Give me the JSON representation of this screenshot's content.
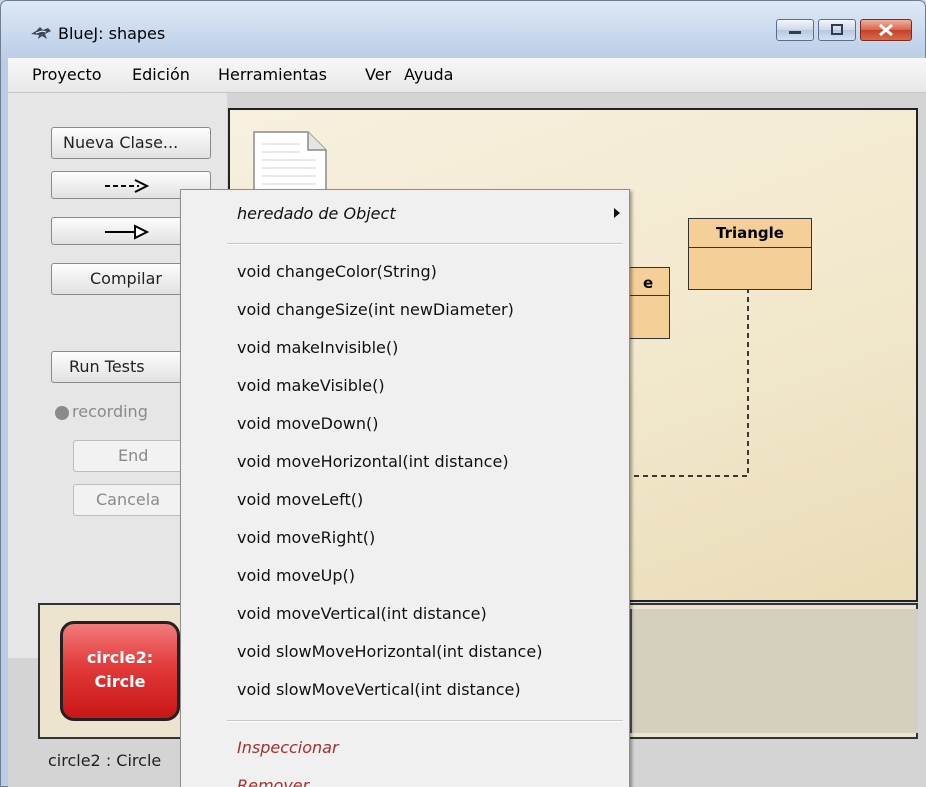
{
  "window": {
    "title": "BlueJ:  shapes"
  },
  "menubar": {
    "items": [
      "Proyecto",
      "Edición",
      "Herramientas",
      "Ver",
      "Ayuda"
    ]
  },
  "toolbar": {
    "new_class": "Nueva Clase...",
    "compile": "Compilar",
    "run_tests": "Run Tests",
    "recording": "recording",
    "end": "End",
    "cancel": "Cancela"
  },
  "diagram": {
    "classes": [
      "Triangle",
      "e"
    ]
  },
  "object_bench": {
    "object_name": "circle2:",
    "object_class": "Circle"
  },
  "status": "circle2 : Circle",
  "context_menu": {
    "inherited": "heredado de Object",
    "methods": [
      "void changeColor(String)",
      "void changeSize(int newDiameter)",
      "void makeInvisible()",
      "void makeVisible()",
      "void moveDown()",
      "void moveHorizontal(int distance)",
      "void moveLeft()",
      "void moveRight()",
      "void moveUp()",
      "void moveVertical(int distance)",
      "void slowMoveHorizontal(int distance)",
      "void slowMoveVertical(int distance)"
    ],
    "inspect": "Inspeccionar",
    "remove": "Remover"
  },
  "colors": {
    "class_fill": "#f5cf98",
    "diagram_bg": "#f2e8cc",
    "object_red": "#e23a3a",
    "action_red": "#a13232"
  }
}
